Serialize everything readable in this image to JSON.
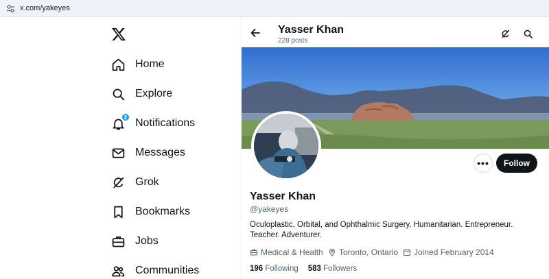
{
  "browser": {
    "url": "x.com/yakeyes"
  },
  "nav": {
    "items": [
      {
        "label": "Home",
        "icon": "home-icon"
      },
      {
        "label": "Explore",
        "icon": "search-icon"
      },
      {
        "label": "Notifications",
        "icon": "bell-icon",
        "badge": "2"
      },
      {
        "label": "Messages",
        "icon": "mail-icon"
      },
      {
        "label": "Grok",
        "icon": "grok-icon"
      },
      {
        "label": "Bookmarks",
        "icon": "bookmark-icon"
      },
      {
        "label": "Jobs",
        "icon": "briefcase-icon"
      },
      {
        "label": "Communities",
        "icon": "people-icon"
      }
    ]
  },
  "header": {
    "name": "Yasser Khan",
    "posts": "228 posts"
  },
  "profile": {
    "name": "Yasser Khan",
    "handle": "@yakeyes",
    "bio": "Oculoplastic, Orbital, and Ophthalmic Surgery. Humanitarian. Entrepreneur. Teacher. Adventurer.",
    "category": "Medical & Health",
    "location": "Toronto, Ontario",
    "joined": "Joined February 2014",
    "following_count": "196",
    "following_label": "Following",
    "followers_count": "583",
    "followers_label": "Followers",
    "more_label": "•••",
    "follow_label": "Follow"
  },
  "colors": {
    "accent": "#1d9bf0",
    "text": "#0f1419",
    "muted": "#536471",
    "button": "#0f1419"
  }
}
